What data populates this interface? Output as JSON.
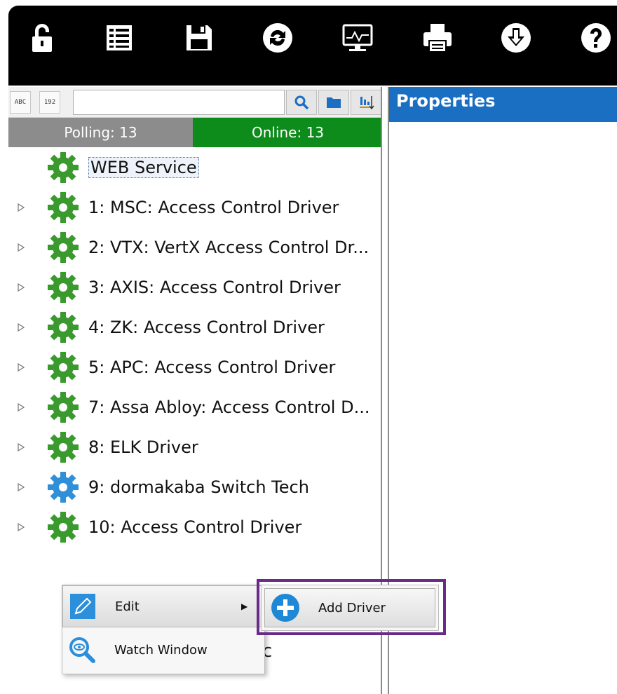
{
  "toolbar": {
    "buttons": [
      {
        "icon": "lock-icon"
      },
      {
        "icon": "list-icon"
      },
      {
        "icon": "save-icon"
      },
      {
        "icon": "refresh-icon"
      },
      {
        "icon": "monitor-icon"
      },
      {
        "icon": "print-icon"
      },
      {
        "icon": "download-icon"
      },
      {
        "icon": "help-icon"
      }
    ]
  },
  "search": {
    "value": "",
    "mode_buttons": [
      "ABC",
      "192"
    ]
  },
  "status": {
    "polling": "Polling:  13",
    "online": "Online:  13"
  },
  "tree": {
    "items": [
      {
        "label": "WEB Service",
        "gear_color": "#3a9a2e",
        "expandable": false,
        "selected": true
      },
      {
        "label": "1:  MSC: Access Control Driver",
        "gear_color": "#3a9a2e",
        "expandable": true
      },
      {
        "label": "2:  VTX: VertX Access Control Dr...",
        "gear_color": "#3a9a2e",
        "expandable": true
      },
      {
        "label": "3:  AXIS: Access Control Driver",
        "gear_color": "#3a9a2e",
        "expandable": true
      },
      {
        "label": "4:  ZK: Access Control Driver",
        "gear_color": "#3a9a2e",
        "expandable": true
      },
      {
        "label": "5:  APC: Access Control Driver",
        "gear_color": "#3a9a2e",
        "expandable": true
      },
      {
        "label": "7:  Assa Abloy: Access Control D...",
        "gear_color": "#3a9a2e",
        "expandable": true
      },
      {
        "label": "8:  ELK Driver",
        "gear_color": "#3a9a2e",
        "expandable": true
      },
      {
        "label": "9:  dormakaba Switch Tech",
        "gear_color": "#2f8fd8",
        "expandable": true
      },
      {
        "label": "10:  Access Control Driver",
        "gear_color": "#3a9a2e",
        "expandable": true
      }
    ]
  },
  "properties": {
    "title": "Properties"
  },
  "context_menu": {
    "items": [
      {
        "label": "Edit",
        "icon": "pencil-icon",
        "has_submenu": true
      },
      {
        "label": "Watch Window",
        "icon": "magnifier-eye-icon",
        "has_submenu": false
      }
    ],
    "submenu": {
      "label": "Add Driver",
      "icon": "plus-circle-icon"
    },
    "arrow": "▶",
    "stray_glyph": "c"
  },
  "colors": {
    "toolbar_bg": "#000000",
    "online_green": "#0d8c1c",
    "polling_gray": "#8c8c8c",
    "properties_blue": "#1a6fc2",
    "highlight_purple": "#6a2a8a"
  }
}
